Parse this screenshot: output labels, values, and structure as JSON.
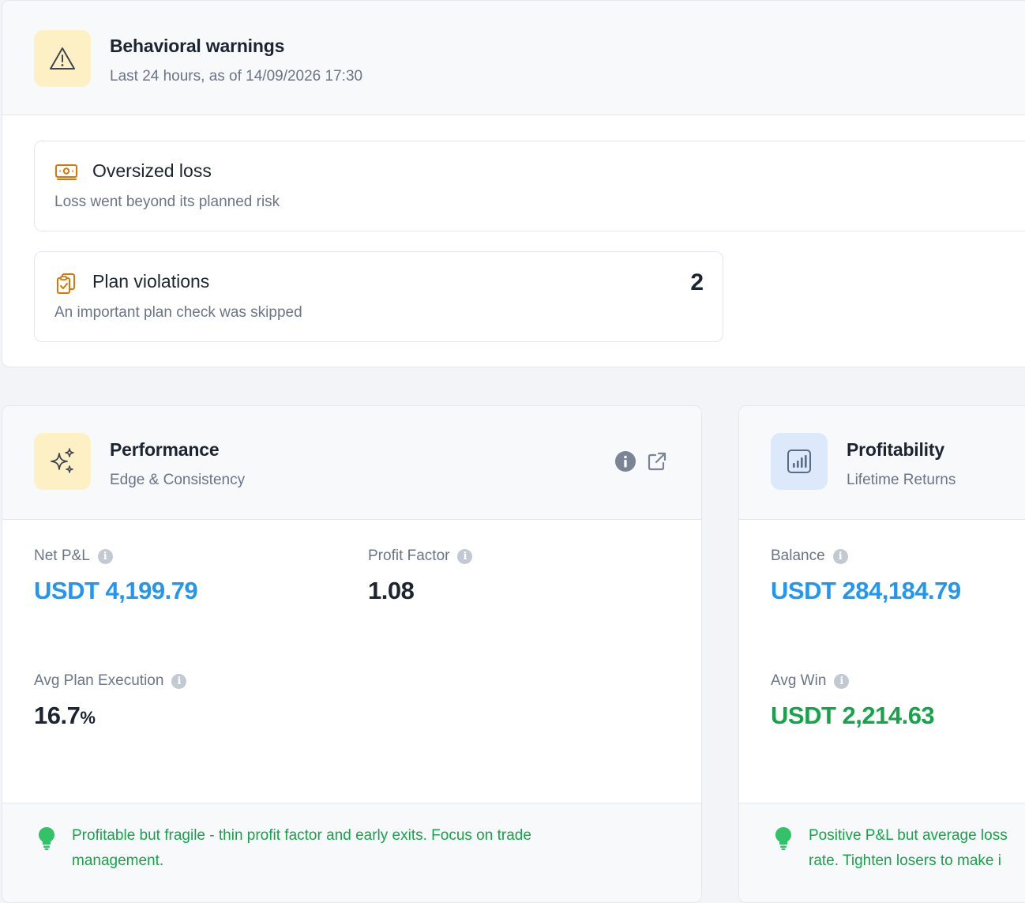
{
  "warnings_card": {
    "title": "Behavioral warnings",
    "subtitle": "Last 24 hours, as of 14/09/2026 17:30",
    "icon": "warning-triangle-icon",
    "items": [
      {
        "title": "Oversized loss",
        "description": "Loss went beyond its planned risk",
        "icon": "money-bills-icon",
        "count": ""
      },
      {
        "title": "Plan violations",
        "description": "An important plan check was skipped",
        "icon": "clipboard-check-icon",
        "count": "2"
      }
    ]
  },
  "performance": {
    "title": "Performance",
    "subtitle": "Edge & Consistency",
    "icon": "sparkles-icon",
    "metrics": {
      "net_pnl": {
        "label": "Net P&L",
        "value": "USDT 4,199.79"
      },
      "profit_factor": {
        "label": "Profit Factor",
        "value": "1.08"
      },
      "avg_plan_execution": {
        "label": "Avg Plan Execution",
        "value": "16.7",
        "unit": "%"
      }
    },
    "tip_line1": "Profitable but fragile - thin profit factor and early exits. Focus on trade",
    "tip_line2": "management."
  },
  "profitability": {
    "title": "Profitability",
    "subtitle": "Lifetime Returns",
    "icon": "bar-chart-icon",
    "metrics": {
      "balance": {
        "label": "Balance",
        "value": "USDT 284,184.79"
      },
      "avg_win": {
        "label": "Avg Win",
        "value": "USDT 2,214.63"
      }
    },
    "tip_line1": "Positive P&L but average loss",
    "tip_line2": "rate. Tighten losers to make i"
  },
  "colors": {
    "accent_blue": "#2196f3",
    "positive_green": "#16a34a",
    "warning_orange": "#d97706",
    "tile_yellow": "#fdf0c4",
    "tile_blue": "#dce9fb"
  }
}
